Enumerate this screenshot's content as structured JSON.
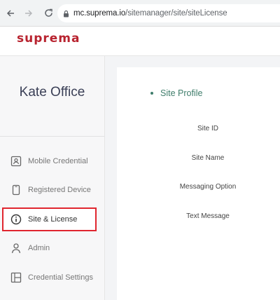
{
  "browser": {
    "url_host": "mc.suprema.io",
    "url_path": "/sitemanager/site/siteLicense"
  },
  "header": {
    "logo_text": "suprema"
  },
  "sidebar": {
    "org_name": "Kate Office",
    "items": [
      {
        "label": "Mobile Credential",
        "icon": "id-card-icon"
      },
      {
        "label": "Registered Device",
        "icon": "phone-icon"
      },
      {
        "label": "Site & License",
        "icon": "info-icon",
        "active": true
      },
      {
        "label": "Admin",
        "icon": "person-icon"
      },
      {
        "label": "Credential Settings",
        "icon": "layout-icon"
      }
    ]
  },
  "main": {
    "section_title": "Site Profile",
    "fields": [
      "Site ID",
      "Site Name",
      "Messaging Option",
      "Text Message"
    ]
  },
  "colors": {
    "brand": "#b8232f",
    "active_border": "#e0262f",
    "section_title": "#3f7d6b"
  }
}
